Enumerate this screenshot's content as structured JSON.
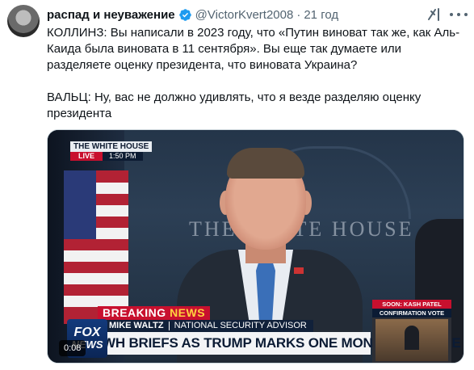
{
  "post": {
    "author_name": "распад и неуважение",
    "handle": "@VictorKvert2008",
    "separator": "·",
    "time": "21 год",
    "verified": true,
    "text_paragraphs": [
      "КОЛЛИНЗ: Вы написали в 2023 году, что «Путин виноват так же, как Аль-Каида была виновата в 11 сентября». Вы еще так думаете или разделяете оценку президента, что виновата Украина?",
      "ВАЛЬЦ: Ну, вас не должно удивлять, что я везде разделяю оценку президента"
    ]
  },
  "icons": {
    "verified": "verified-badge-icon",
    "grok": "grok-icon",
    "more": "more-icon"
  },
  "video": {
    "bug_title": "THE WHITE HOUSE",
    "live_label": "LIVE",
    "live_time": "1:50 PM",
    "wall_sign": "THE WHITE HOUSE",
    "breaking_prefix": "BREAKING",
    "breaking_suffix": "NEWS",
    "lower_name": "MIKE WALTZ",
    "lower_role": "NATIONAL SECURITY ADVISOR",
    "headline": "WH BRIEFS AS TRUMP MARKS ONE MONTH IN OFFICE",
    "network_top": "FOX",
    "network_bottom": "NEWS",
    "soon_title": "SOON: KASH PATEL",
    "soon_subtitle": "CONFIRMATION VOTE",
    "timestamp": "0:08"
  },
  "colors": {
    "verified_blue": "#1d9bf0",
    "breaking_red": "#c8102e",
    "navy": "#0b1b34"
  }
}
